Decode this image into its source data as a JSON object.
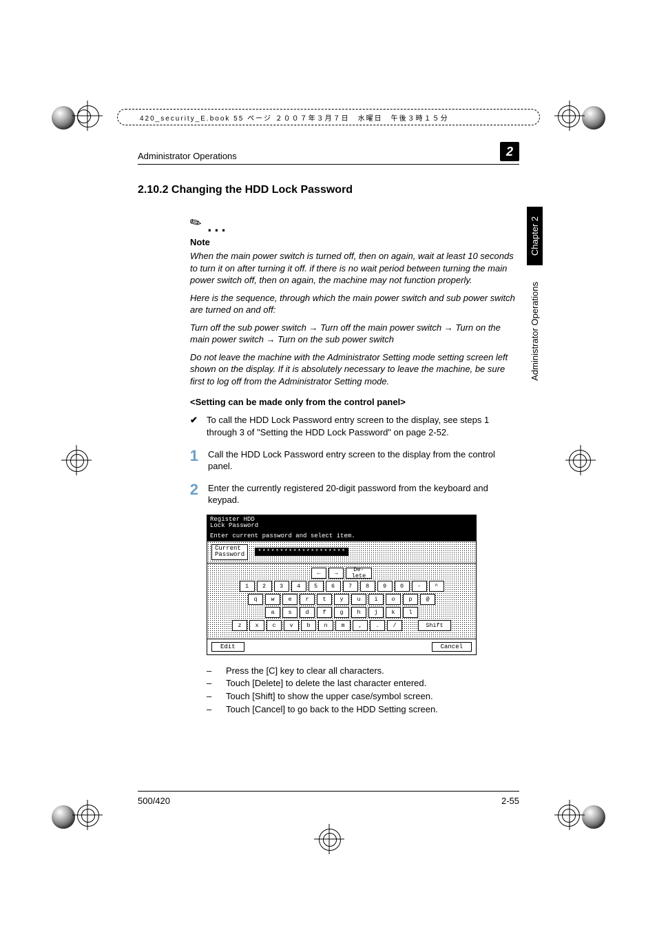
{
  "top_strip": {
    "filename": "420_security_E.book  55 ページ  ２００７年３月７日　水曜日　午後３時１５分"
  },
  "running_head": {
    "title": "Administrator Operations",
    "chapter_digit": "2"
  },
  "section": {
    "number_title": "2.10.2  Changing the HDD Lock Password"
  },
  "note": {
    "label": "Note",
    "p1": "When the main power switch is turned off, then on again, wait at least 10 seconds to turn it on after turning it off. if there is no wait period between turning the main power switch off, then on again, the machine may not function properly.",
    "p2": "Here is the sequence, through which the main power switch and sub power switch are turned on and off:",
    "p3_pre": "Turn off the sub power switch ",
    "p3_mid1": " Turn off the main power switch ",
    "p3_mid2": " Turn on the main power switch ",
    "p3_end": " Turn on the sub power switch",
    "p4": "Do not leave the machine with the Administrator Setting mode setting screen left shown on the display. If it is absolutely necessary to leave the machine, be sure first to log off from the Administrator Setting mode."
  },
  "sub_heading": "<Setting can be made only from the control panel>",
  "check": {
    "mark": "✔",
    "text": "To call the HDD Lock Password entry screen to the display, see steps 1 through 3 of \"Setting the HDD Lock Password\" on page 2-52."
  },
  "steps": {
    "s1_num": "1",
    "s1_text": "Call the HDD Lock Password entry screen to the display from the control panel.",
    "s2_num": "2",
    "s2_text": "Enter the currently registered 20-digit password from the keyboard and keypad."
  },
  "panel": {
    "title_l1": "Register HDD",
    "title_l2": "Lock Password",
    "subtitle": "Enter current password and select item.",
    "current_l1": "Current",
    "current_l2": "Password",
    "mask": "********************",
    "nav_left": "←",
    "nav_right": "→",
    "delete_l": "De-\nlete",
    "row_num": [
      "1",
      "2",
      "3",
      "4",
      "5",
      "6",
      "7",
      "8",
      "9",
      "0",
      "-",
      "^"
    ],
    "row_q": [
      "q",
      "w",
      "e",
      "r",
      "t",
      "y",
      "u",
      "i",
      "o",
      "p",
      "@"
    ],
    "row_a": [
      "a",
      "s",
      "d",
      "f",
      "g",
      "h",
      "j",
      "k",
      "l"
    ],
    "row_z": [
      "z",
      "x",
      "c",
      "v",
      "b",
      "n",
      "m",
      ",",
      ".",
      "/"
    ],
    "shift": "Shift",
    "edit": "Edit",
    "cancel": "Cancel"
  },
  "bullets": {
    "b1": "Press the [C] key to clear all characters.",
    "b2": "Touch [Delete] to delete the last character entered.",
    "b3": "Touch [Shift] to show the upper case/symbol screen.",
    "b4": "Touch [Cancel] to go back to the HDD Setting screen."
  },
  "footer": {
    "left": "500/420",
    "right": "2-55"
  },
  "side": {
    "chapter": "Chapter 2",
    "ops": "Administrator Operations"
  }
}
